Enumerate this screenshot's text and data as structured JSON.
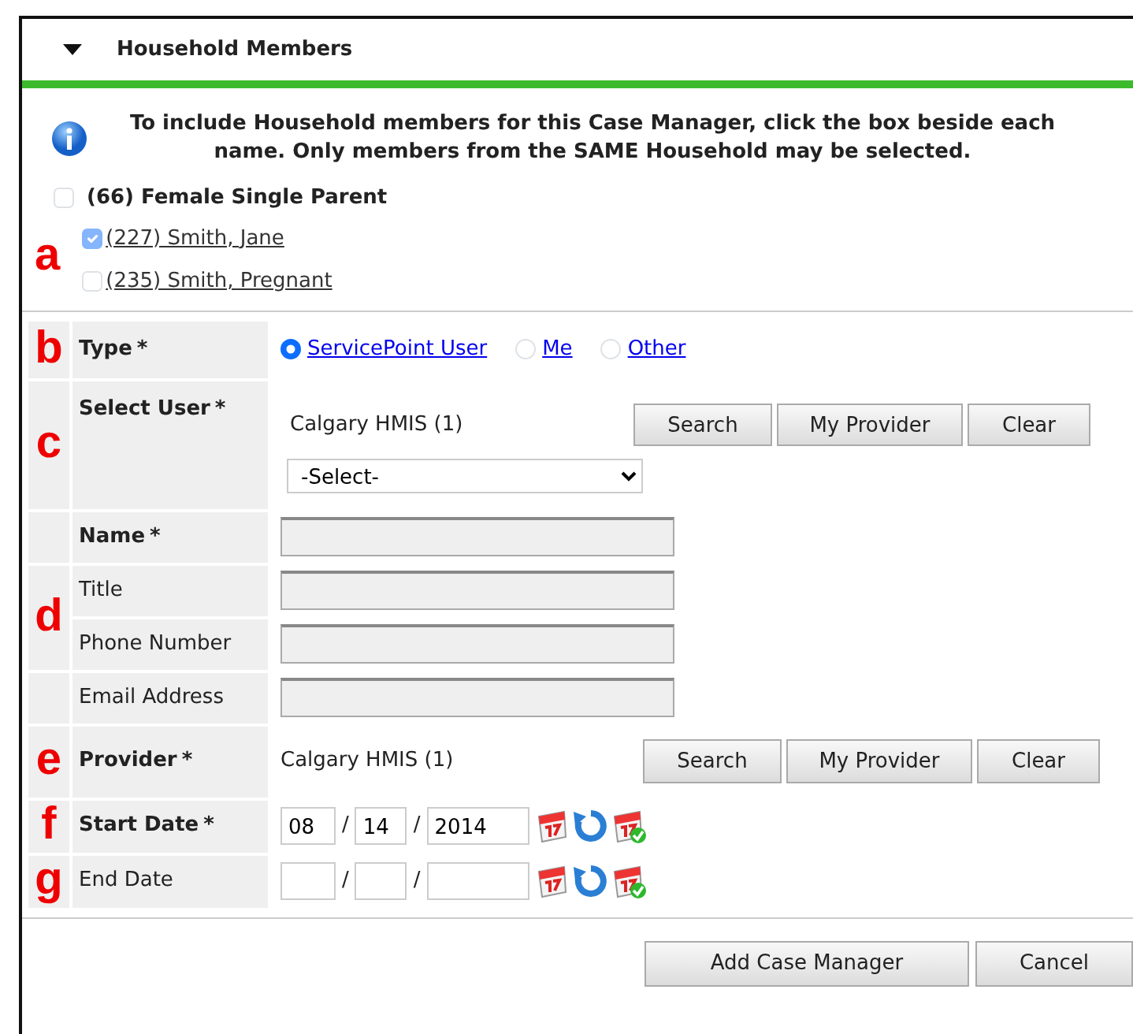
{
  "panel": {
    "title": "Household Members",
    "expanded": true
  },
  "info": "To include Household members for this Case Manager, click the box beside each name. Only members from the SAME Household may be selected.",
  "household": {
    "label": "(66) Female Single Parent",
    "checked": false,
    "marker": "a",
    "members": [
      {
        "label": "(227) Smith, Jane",
        "checked": true,
        "disabled": true
      },
      {
        "label": "(235) Smith, Pregnant",
        "checked": false,
        "disabled": false
      }
    ]
  },
  "groups": [
    {
      "marker": "b",
      "fields": [
        {
          "kind": "radio",
          "label": "Type",
          "required": true,
          "required_mark": "*",
          "options": [
            {
              "label": "ServicePoint User",
              "selected": true
            },
            {
              "label": "Me",
              "selected": false
            },
            {
              "label": "Other",
              "selected": false
            }
          ]
        }
      ]
    },
    {
      "marker": "c",
      "fields": [
        {
          "kind": "user",
          "label": "Select User",
          "required": true,
          "required_mark": "*",
          "provider": "Calgary HMIS (1)",
          "buttons": [
            "Search",
            "My Provider",
            "Clear"
          ],
          "select": "-Select-"
        }
      ]
    },
    {
      "fields": [
        {
          "kind": "text",
          "label": "Name",
          "required": true,
          "required_mark": "*",
          "disabled": true
        }
      ]
    },
    {
      "marker": "d",
      "fields": [
        {
          "kind": "text",
          "label": "Title",
          "required": false,
          "disabled": true
        },
        {
          "kind": "text",
          "label": "Phone Number",
          "required": false,
          "disabled": true
        }
      ]
    },
    {
      "fields": [
        {
          "kind": "text",
          "label": "Email Address",
          "required": false,
          "disabled": true
        }
      ]
    },
    {
      "marker": "e",
      "fields": [
        {
          "kind": "provider",
          "label": "Provider",
          "required": true,
          "required_mark": "*",
          "provider": "Calgary HMIS (1)",
          "buttons": [
            "Search",
            "My Provider",
            "Clear"
          ]
        }
      ]
    },
    {
      "marker": "f",
      "fields": [
        {
          "kind": "date",
          "label": "Start Date",
          "required": true,
          "required_mark": "*",
          "month": "08",
          "day": "14",
          "year": "2014",
          "separators": [
            "/",
            "/"
          ]
        }
      ]
    },
    {
      "marker": "g",
      "fields": [
        {
          "kind": "date",
          "label": "End Date",
          "required": false,
          "separators": [
            "/",
            "/"
          ]
        }
      ]
    }
  ],
  "buttons": [
    "Add Case Manager",
    "Cancel"
  ]
}
